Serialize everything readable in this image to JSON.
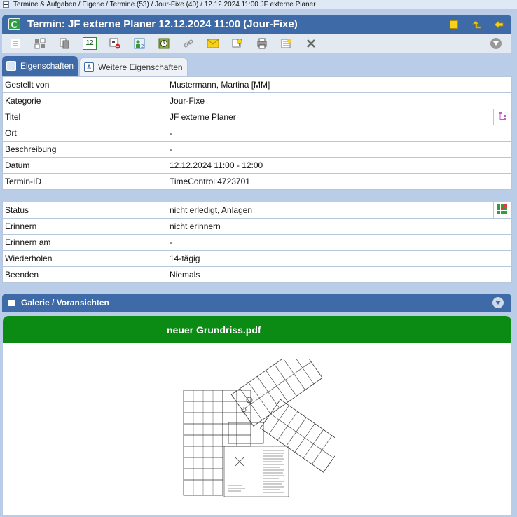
{
  "breadcrumb": "Termine & Aufgaben / Eigene / Termine (53) / Jour-Fixe (40) / 12.12.2024 11:00 JF externe Planer",
  "window": {
    "title": "Termin: JF externe Planer 12.12.2024 11:00 (Jour-Fixe)",
    "icons": [
      "list-icon",
      "folder-up-icon",
      "arrow-left-icon"
    ]
  },
  "toolbar": {
    "calendar_day": "12",
    "icons": [
      "properties-icon",
      "tiles-icon",
      "copy-icon",
      "calendar-icon",
      "delete-appointment-icon",
      "participants-icon",
      "clock-icon",
      "link-icon",
      "mail-icon",
      "idea-icon",
      "print-icon",
      "notes-icon",
      "close-icon",
      "dropdown-icon"
    ]
  },
  "tabs": [
    {
      "label": "Eigenschaften",
      "active": true
    },
    {
      "label": "Weitere Eigenschaften",
      "active": false
    }
  ],
  "properties_top": [
    {
      "key": "Gestellt von",
      "value": "Mustermann, Martina [MM]"
    },
    {
      "key": "Kategorie",
      "value": "Jour-Fixe"
    },
    {
      "key": "Titel",
      "value": "JF externe Planer"
    },
    {
      "key": "Ort",
      "value": "-"
    },
    {
      "key": "Beschreibung",
      "value": "-"
    },
    {
      "key": "Datum",
      "value": "12.12.2024 11:00 - 12:00"
    },
    {
      "key": "Termin-ID",
      "value": "TimeControl:4723701"
    }
  ],
  "properties_bottom": [
    {
      "key": "Status",
      "value": "nicht erledigt, Anlagen"
    },
    {
      "key": "Erinnern",
      "value": "nicht erinnern"
    },
    {
      "key": "Erinnern am",
      "value": "-"
    },
    {
      "key": "Wiederholen",
      "value": "14-tägig"
    },
    {
      "key": "Beenden",
      "value": "Niemals"
    }
  ],
  "gallery": {
    "header": "Galerie / Voransichten",
    "file_name": "neuer Grundriss.pdf"
  },
  "colors": {
    "header_blue": "#3e6aa7",
    "background": "#b9cde8",
    "banner_green": "#0b8a14",
    "toolbar_yellow": "#f6d21c"
  }
}
